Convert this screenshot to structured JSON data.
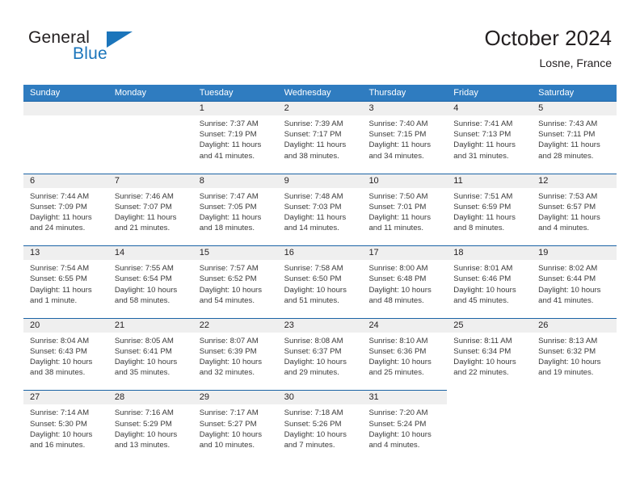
{
  "brand": {
    "name_part1": "General",
    "name_part2": "Blue",
    "triangle_color": "#1b75bb"
  },
  "header": {
    "title": "October 2024",
    "location": "Losne, France"
  },
  "theme": {
    "header_blue": "#2f7cc0",
    "rule_blue": "#1b63a5",
    "datestrip_gray": "#efefef",
    "text": "#231f20"
  },
  "weekday_headers": [
    "Sunday",
    "Monday",
    "Tuesday",
    "Wednesday",
    "Thursday",
    "Friday",
    "Saturday"
  ],
  "labels": {
    "sunrise_prefix": "Sunrise:",
    "sunset_prefix": "Sunset:",
    "daylight_prefix": "Daylight:"
  },
  "weeks": [
    [
      {
        "day": "",
        "sunrise": "",
        "sunset": "",
        "daylight_line1": "",
        "daylight_line2": ""
      },
      {
        "day": "",
        "sunrise": "",
        "sunset": "",
        "daylight_line1": "",
        "daylight_line2": ""
      },
      {
        "day": "1",
        "sunrise": "Sunrise: 7:37 AM",
        "sunset": "Sunset: 7:19 PM",
        "daylight_line1": "Daylight: 11 hours",
        "daylight_line2": "and 41 minutes."
      },
      {
        "day": "2",
        "sunrise": "Sunrise: 7:39 AM",
        "sunset": "Sunset: 7:17 PM",
        "daylight_line1": "Daylight: 11 hours",
        "daylight_line2": "and 38 minutes."
      },
      {
        "day": "3",
        "sunrise": "Sunrise: 7:40 AM",
        "sunset": "Sunset: 7:15 PM",
        "daylight_line1": "Daylight: 11 hours",
        "daylight_line2": "and 34 minutes."
      },
      {
        "day": "4",
        "sunrise": "Sunrise: 7:41 AM",
        "sunset": "Sunset: 7:13 PM",
        "daylight_line1": "Daylight: 11 hours",
        "daylight_line2": "and 31 minutes."
      },
      {
        "day": "5",
        "sunrise": "Sunrise: 7:43 AM",
        "sunset": "Sunset: 7:11 PM",
        "daylight_line1": "Daylight: 11 hours",
        "daylight_line2": "and 28 minutes."
      }
    ],
    [
      {
        "day": "6",
        "sunrise": "Sunrise: 7:44 AM",
        "sunset": "Sunset: 7:09 PM",
        "daylight_line1": "Daylight: 11 hours",
        "daylight_line2": "and 24 minutes."
      },
      {
        "day": "7",
        "sunrise": "Sunrise: 7:46 AM",
        "sunset": "Sunset: 7:07 PM",
        "daylight_line1": "Daylight: 11 hours",
        "daylight_line2": "and 21 minutes."
      },
      {
        "day": "8",
        "sunrise": "Sunrise: 7:47 AM",
        "sunset": "Sunset: 7:05 PM",
        "daylight_line1": "Daylight: 11 hours",
        "daylight_line2": "and 18 minutes."
      },
      {
        "day": "9",
        "sunrise": "Sunrise: 7:48 AM",
        "sunset": "Sunset: 7:03 PM",
        "daylight_line1": "Daylight: 11 hours",
        "daylight_line2": "and 14 minutes."
      },
      {
        "day": "10",
        "sunrise": "Sunrise: 7:50 AM",
        "sunset": "Sunset: 7:01 PM",
        "daylight_line1": "Daylight: 11 hours",
        "daylight_line2": "and 11 minutes."
      },
      {
        "day": "11",
        "sunrise": "Sunrise: 7:51 AM",
        "sunset": "Sunset: 6:59 PM",
        "daylight_line1": "Daylight: 11 hours",
        "daylight_line2": "and 8 minutes."
      },
      {
        "day": "12",
        "sunrise": "Sunrise: 7:53 AM",
        "sunset": "Sunset: 6:57 PM",
        "daylight_line1": "Daylight: 11 hours",
        "daylight_line2": "and 4 minutes."
      }
    ],
    [
      {
        "day": "13",
        "sunrise": "Sunrise: 7:54 AM",
        "sunset": "Sunset: 6:55 PM",
        "daylight_line1": "Daylight: 11 hours",
        "daylight_line2": "and 1 minute."
      },
      {
        "day": "14",
        "sunrise": "Sunrise: 7:55 AM",
        "sunset": "Sunset: 6:54 PM",
        "daylight_line1": "Daylight: 10 hours",
        "daylight_line2": "and 58 minutes."
      },
      {
        "day": "15",
        "sunrise": "Sunrise: 7:57 AM",
        "sunset": "Sunset: 6:52 PM",
        "daylight_line1": "Daylight: 10 hours",
        "daylight_line2": "and 54 minutes."
      },
      {
        "day": "16",
        "sunrise": "Sunrise: 7:58 AM",
        "sunset": "Sunset: 6:50 PM",
        "daylight_line1": "Daylight: 10 hours",
        "daylight_line2": "and 51 minutes."
      },
      {
        "day": "17",
        "sunrise": "Sunrise: 8:00 AM",
        "sunset": "Sunset: 6:48 PM",
        "daylight_line1": "Daylight: 10 hours",
        "daylight_line2": "and 48 minutes."
      },
      {
        "day": "18",
        "sunrise": "Sunrise: 8:01 AM",
        "sunset": "Sunset: 6:46 PM",
        "daylight_line1": "Daylight: 10 hours",
        "daylight_line2": "and 45 minutes."
      },
      {
        "day": "19",
        "sunrise": "Sunrise: 8:02 AM",
        "sunset": "Sunset: 6:44 PM",
        "daylight_line1": "Daylight: 10 hours",
        "daylight_line2": "and 41 minutes."
      }
    ],
    [
      {
        "day": "20",
        "sunrise": "Sunrise: 8:04 AM",
        "sunset": "Sunset: 6:43 PM",
        "daylight_line1": "Daylight: 10 hours",
        "daylight_line2": "and 38 minutes."
      },
      {
        "day": "21",
        "sunrise": "Sunrise: 8:05 AM",
        "sunset": "Sunset: 6:41 PM",
        "daylight_line1": "Daylight: 10 hours",
        "daylight_line2": "and 35 minutes."
      },
      {
        "day": "22",
        "sunrise": "Sunrise: 8:07 AM",
        "sunset": "Sunset: 6:39 PM",
        "daylight_line1": "Daylight: 10 hours",
        "daylight_line2": "and 32 minutes."
      },
      {
        "day": "23",
        "sunrise": "Sunrise: 8:08 AM",
        "sunset": "Sunset: 6:37 PM",
        "daylight_line1": "Daylight: 10 hours",
        "daylight_line2": "and 29 minutes."
      },
      {
        "day": "24",
        "sunrise": "Sunrise: 8:10 AM",
        "sunset": "Sunset: 6:36 PM",
        "daylight_line1": "Daylight: 10 hours",
        "daylight_line2": "and 25 minutes."
      },
      {
        "day": "25",
        "sunrise": "Sunrise: 8:11 AM",
        "sunset": "Sunset: 6:34 PM",
        "daylight_line1": "Daylight: 10 hours",
        "daylight_line2": "and 22 minutes."
      },
      {
        "day": "26",
        "sunrise": "Sunrise: 8:13 AM",
        "sunset": "Sunset: 6:32 PM",
        "daylight_line1": "Daylight: 10 hours",
        "daylight_line2": "and 19 minutes."
      }
    ],
    [
      {
        "day": "27",
        "sunrise": "Sunrise: 7:14 AM",
        "sunset": "Sunset: 5:30 PM",
        "daylight_line1": "Daylight: 10 hours",
        "daylight_line2": "and 16 minutes."
      },
      {
        "day": "28",
        "sunrise": "Sunrise: 7:16 AM",
        "sunset": "Sunset: 5:29 PM",
        "daylight_line1": "Daylight: 10 hours",
        "daylight_line2": "and 13 minutes."
      },
      {
        "day": "29",
        "sunrise": "Sunrise: 7:17 AM",
        "sunset": "Sunset: 5:27 PM",
        "daylight_line1": "Daylight: 10 hours",
        "daylight_line2": "and 10 minutes."
      },
      {
        "day": "30",
        "sunrise": "Sunrise: 7:18 AM",
        "sunset": "Sunset: 5:26 PM",
        "daylight_line1": "Daylight: 10 hours",
        "daylight_line2": "and 7 minutes."
      },
      {
        "day": "31",
        "sunrise": "Sunrise: 7:20 AM",
        "sunset": "Sunset: 5:24 PM",
        "daylight_line1": "Daylight: 10 hours",
        "daylight_line2": "and 4 minutes."
      },
      {
        "day": "",
        "sunrise": "",
        "sunset": "",
        "daylight_line1": "",
        "daylight_line2": ""
      },
      {
        "day": "",
        "sunrise": "",
        "sunset": "",
        "daylight_line1": "",
        "daylight_line2": ""
      }
    ]
  ]
}
